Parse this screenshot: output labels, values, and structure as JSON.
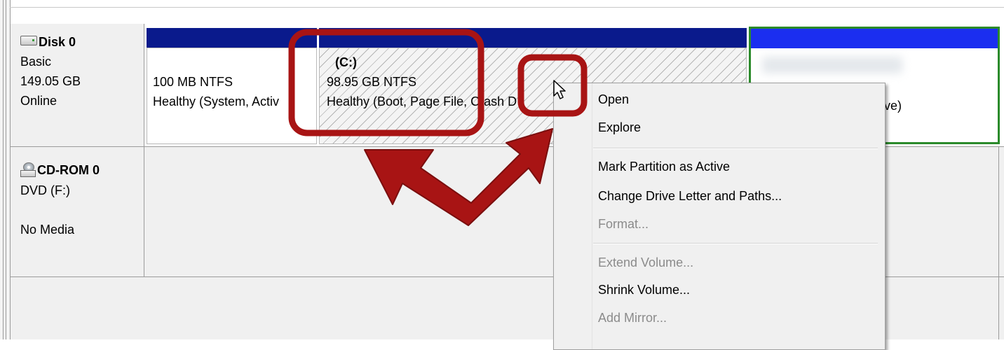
{
  "disks": [
    {
      "name": "Disk 0",
      "type": "Basic",
      "size": "149.05 GB",
      "status": "Online",
      "icon": "hard-disk-icon",
      "partitions": [
        {
          "size_fs": "100 MB NTFS",
          "status": "Healthy (System, Activ"
        },
        {
          "label": "(C:)",
          "size_fs": "98.95 GB NTFS",
          "status": "Healthy (Boot, Page File, Crash D"
        },
        {
          "status_tail": "rive)"
        }
      ]
    },
    {
      "name": "CD-ROM 0",
      "type": "DVD (F:)",
      "status": "No Media",
      "icon": "cd-drive-icon"
    }
  ],
  "context_menu": {
    "items": [
      {
        "label": "Open",
        "enabled": true
      },
      {
        "label": "Explore",
        "enabled": true
      },
      {
        "label": "Mark Partition as Active",
        "enabled": true
      },
      {
        "label": "Change Drive Letter and Paths...",
        "enabled": true
      },
      {
        "label": "Format...",
        "enabled": false
      },
      {
        "label": "Extend Volume...",
        "enabled": false
      },
      {
        "label": "Shrink Volume...",
        "enabled": true
      },
      {
        "label": "Add Mirror...",
        "enabled": false
      }
    ]
  },
  "colors": {
    "partition_bar": "#0a1a8c",
    "selected_partition_bar": "#1b2ef0",
    "selection_border": "#2a8a2a",
    "annotation": "#b01515"
  }
}
